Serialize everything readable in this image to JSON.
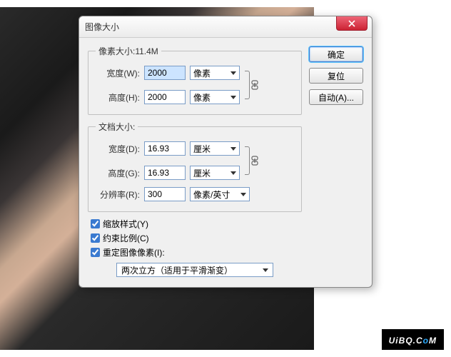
{
  "dialog": {
    "title": "图像大小",
    "buttons": {
      "ok": "确定",
      "reset": "复位",
      "auto": "自动(A)..."
    },
    "pixelSize": {
      "legend": "像素大小:11.4M",
      "widthLabel": "宽度(W):",
      "widthValue": "2000",
      "widthUnit": "像素",
      "heightLabel": "高度(H):",
      "heightValue": "2000",
      "heightUnit": "像素"
    },
    "docSize": {
      "legend": "文档大小:",
      "widthLabel": "宽度(D):",
      "widthValue": "16.93",
      "widthUnit": "厘米",
      "heightLabel": "高度(G):",
      "heightValue": "16.93",
      "heightUnit": "厘米",
      "resLabel": "分辨率(R):",
      "resValue": "300",
      "resUnit": "像素/英寸"
    },
    "checks": {
      "scaleStyles": "缩放样式(Y)",
      "constrain": "约束比例(C)",
      "resample": "重定图像像素(I):"
    },
    "resampleMethod": "两次立方（适用于平滑渐变）"
  },
  "watermark": {
    "pre": "UiB",
    "mid": "Q",
    "post": ".C",
    "o": "o",
    "m": "M"
  }
}
